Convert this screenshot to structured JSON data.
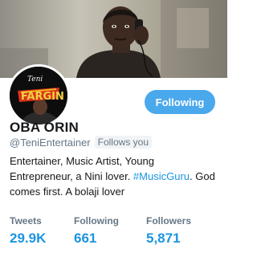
{
  "profile": {
    "name": "OBA ORIN",
    "handle": "@TeniEntertainer",
    "follows_you": "Follows you",
    "follow_button_label": "Following",
    "bio_line1_part1": "Entertainer, Music Artist, Young Entrepreneur, a Nini lover. ",
    "bio_hashtag": "#MusicGuru",
    "bio_line1_part2": ". God comes first. A bolaji lover",
    "avatar_logo_text": "Teni",
    "avatar_logo_sub": "FARGIN"
  },
  "stats": [
    {
      "label": "Tweets",
      "value": "29.9K"
    },
    {
      "label": "Following",
      "value": "661"
    },
    {
      "label": "Followers",
      "value": "5,871"
    }
  ],
  "colors": {
    "accent": "#1b95e0",
    "button": "#4aa8ec",
    "muted": "#657786",
    "text": "#14171a"
  }
}
